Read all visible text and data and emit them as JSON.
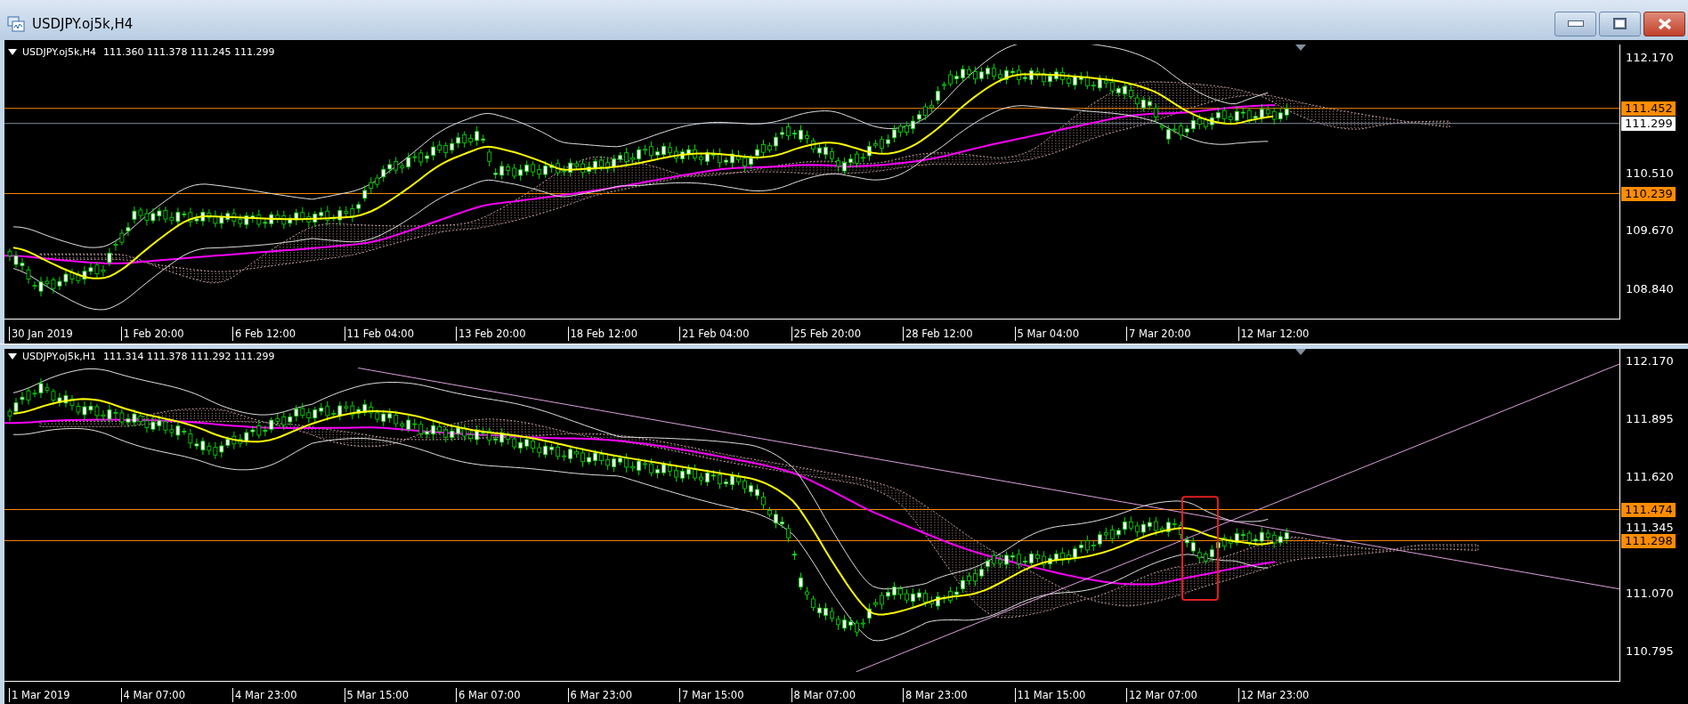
{
  "window": {
    "title": "USDJPY.oj5k,H4"
  },
  "panes": [
    {
      "legend": {
        "symbol": "USDJPY.oj5k,H4",
        "ohlc": [
          "111.360",
          "111.378",
          "111.245",
          "111.299"
        ]
      },
      "price_labels": [
        {
          "text": "112.170",
          "kind": "tick"
        },
        {
          "text": "111.452",
          "kind": "level"
        },
        {
          "text": "111.299",
          "kind": "current"
        },
        {
          "text": "110.510",
          "kind": "tick"
        },
        {
          "text": "110.239",
          "kind": "level"
        },
        {
          "text": "109.670",
          "kind": "tick"
        },
        {
          "text": "108.840",
          "kind": "tick"
        }
      ],
      "time_labels": [
        "30 Jan 2019",
        "1 Feb 20:00",
        "6 Feb 12:00",
        "11 Feb 04:00",
        "13 Feb 20:00",
        "18 Feb 12:00",
        "21 Feb 04:00",
        "25 Feb 20:00",
        "28 Feb 12:00",
        "5 Mar 04:00",
        "7 Mar 20:00",
        "12 Mar 12:00"
      ]
    },
    {
      "legend": {
        "symbol": "USDJPY.oj5k,H1",
        "ohlc": [
          "111.314",
          "111.378",
          "111.292",
          "111.299"
        ]
      },
      "price_labels": [
        {
          "text": "112.170",
          "kind": "tick"
        },
        {
          "text": "111.895",
          "kind": "tick"
        },
        {
          "text": "111.620",
          "kind": "tick"
        },
        {
          "text": "111.474",
          "kind": "level"
        },
        {
          "text": "111.345",
          "kind": "tick"
        },
        {
          "text": "111.298",
          "kind": "level"
        },
        {
          "text": "111.070",
          "kind": "tick"
        },
        {
          "text": "110.795",
          "kind": "tick"
        }
      ],
      "time_labels": [
        "1 Mar 2019",
        "4 Mar 07:00",
        "4 Mar 23:00",
        "5 Mar 15:00",
        "6 Mar 07:00",
        "6 Mar 23:00",
        "7 Mar 15:00",
        "8 Mar 07:00",
        "8 Mar 23:00",
        "11 Mar 15:00",
        "12 Mar 07:00",
        "12 Mar 23:00"
      ]
    }
  ]
}
